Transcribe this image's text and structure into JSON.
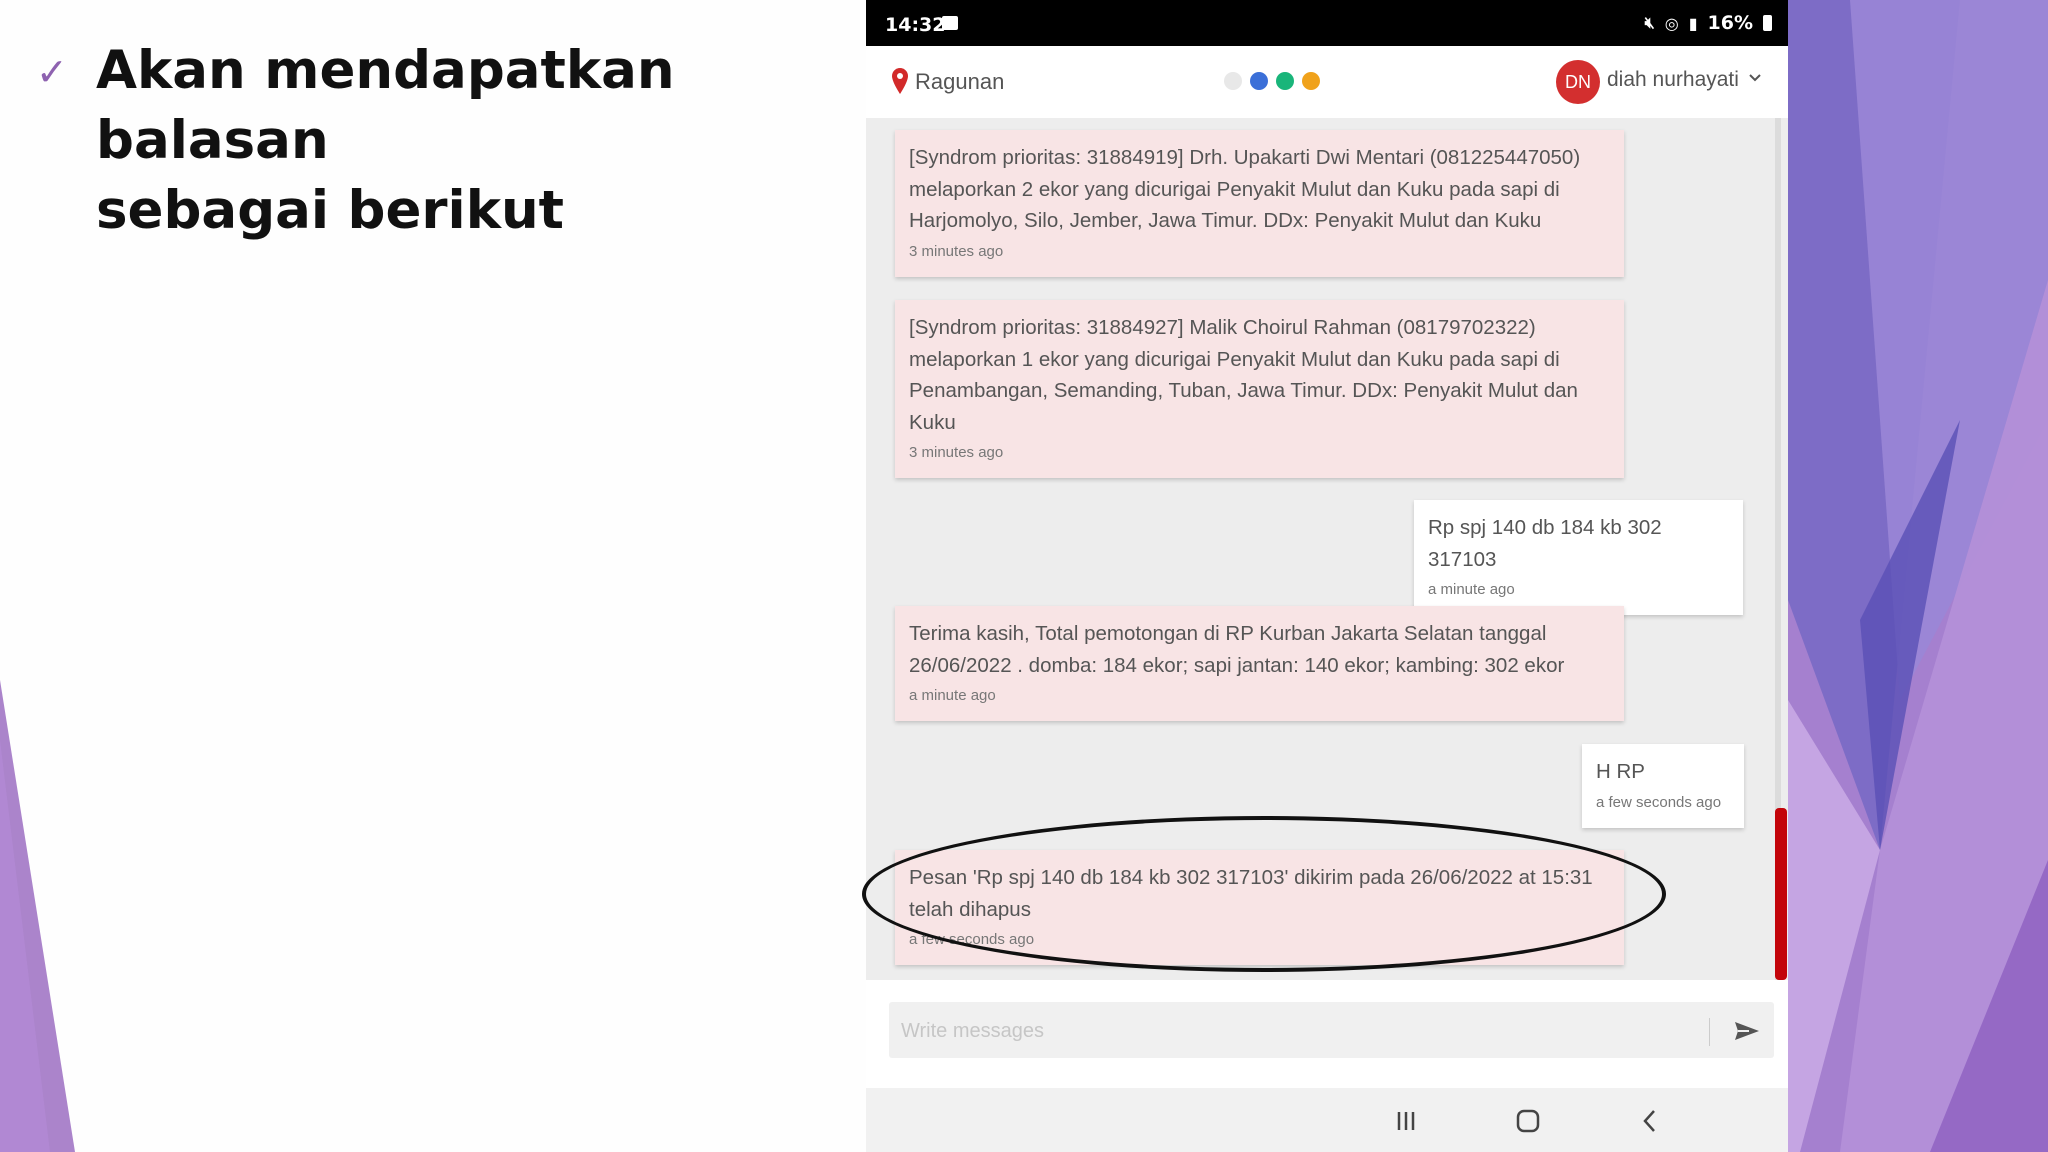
{
  "slide": {
    "bullet_icon": "checkmark-icon",
    "bullet_line1": "Akan mendapatkan balasan",
    "bullet_line2": "sebagai berikut",
    "accent_colors": [
      "#8e62b0",
      "#6f5fc0",
      "#b28ad6"
    ]
  },
  "phone": {
    "status_bar": {
      "time": "14:32",
      "battery": "16%"
    },
    "header": {
      "location": "Ragunan",
      "avatar_initials": "DN",
      "avatar_color": "#d32f2f",
      "user_name": "diah nurhayati",
      "status_dots": [
        "#e8e8e8",
        "#3b6fd8",
        "#19b57a",
        "#f0a21b"
      ]
    },
    "messages": [
      {
        "side": "in",
        "lines": [
          "[Syndrom prioritas: 31884919] Drh. Upakarti Dwi Mentari (081225447050)",
          "melaporkan 2 ekor yang dicurigai Penyakit Mulut dan Kuku pada sapi di",
          "Harjomolyo, Silo, Jember, Jawa Timur. DDx: Penyakit Mulut dan Kuku"
        ],
        "time": "3 minutes ago"
      },
      {
        "side": "in",
        "lines": [
          "[Syndrom prioritas: 31884927] Malik Choirul Rahman (08179702322)",
          "melaporkan 1 ekor yang dicurigai Penyakit Mulut dan Kuku pada sapi di",
          "Penambangan, Semanding, Tuban, Jawa Timur. DDx: Penyakit Mulut dan",
          "Kuku"
        ],
        "time": "3 minutes ago"
      },
      {
        "side": "out",
        "lines": [
          "Rp spj 140 db 184 kb 302 317103"
        ],
        "time": "a minute ago"
      },
      {
        "side": "in",
        "lines": [
          "Terima kasih, Total pemotongan di RP Kurban Jakarta Selatan tanggal",
          "26/06/2022 . domba: 184 ekor; sapi jantan: 140 ekor; kambing: 302 ekor"
        ],
        "time": "a minute ago"
      },
      {
        "side": "out",
        "lines": [
          "H RP"
        ],
        "time": "a few seconds ago"
      },
      {
        "side": "in",
        "lines": [
          "Pesan 'Rp spj 140 db 184 kb 302 317103' dikirim pada 26/06/2022 at 15:31",
          "telah dihapus"
        ],
        "time": "a few seconds ago"
      }
    ],
    "composer": {
      "placeholder": "Write messages"
    },
    "scroll_accent_color": "#c3040a"
  }
}
